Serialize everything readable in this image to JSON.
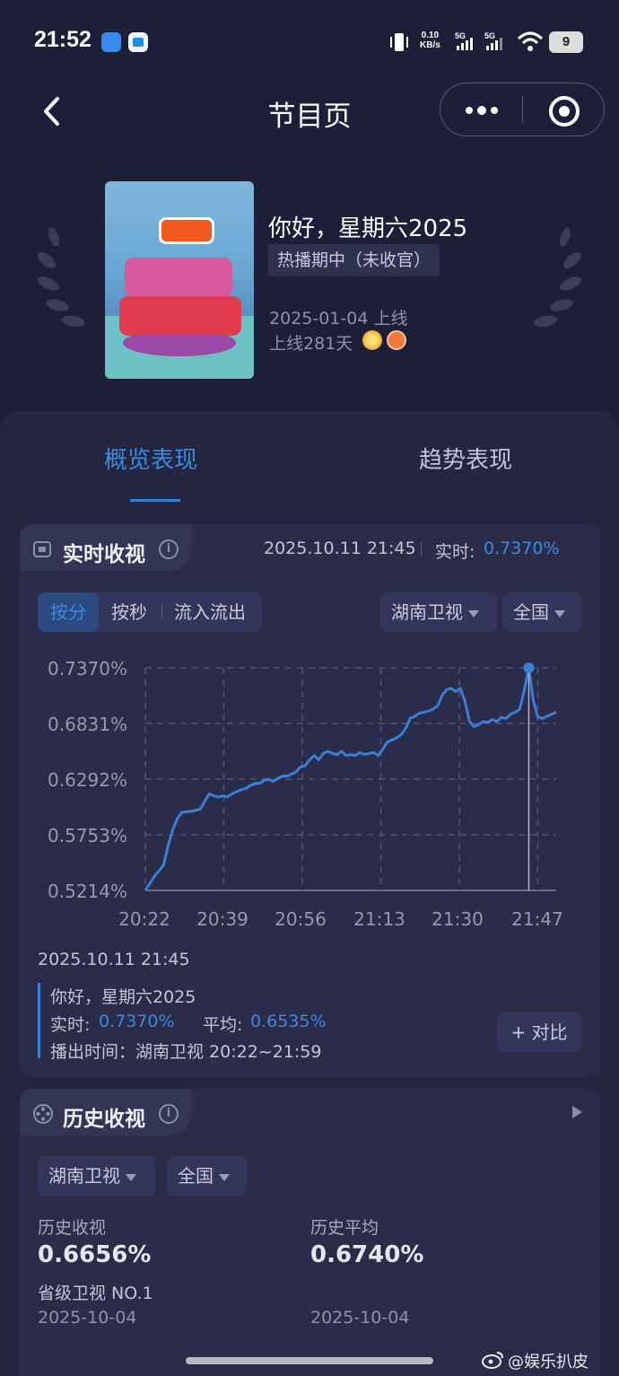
{
  "status_bar": {
    "time": "21:52",
    "net_speed_value": "0.10",
    "net_speed_unit": "KB/s",
    "sig1": "5G",
    "sig2": "5G",
    "battery": "9"
  },
  "nav": {
    "title": "节目页"
  },
  "show": {
    "title": "你好，星期六2025",
    "status": "热播期中（未收官）",
    "launch_date": "2025-01-04 上线",
    "launch_days": "上线281天"
  },
  "tabs": [
    "概览表现",
    "趋势表现"
  ],
  "realtime": {
    "title": "实时收视",
    "timestamp": "2025.10.11 21:45",
    "realtime_label": "实时:",
    "realtime_value": "0.7370%",
    "segments": [
      "按分",
      "按秒",
      "流入流出"
    ],
    "channel": "湖南卫视",
    "region": "全国",
    "detail_time": "2025.10.11 21:45",
    "detail_show": "你好，星期六2025",
    "detail_rt_label": "实时:",
    "detail_rt_value": "0.7370%",
    "detail_avg_label": "平均:",
    "detail_avg_value": "0.6535%",
    "air_time": "播出时间：湖南卫视 20:22~21:59",
    "compare_button": "+ 对比"
  },
  "chart_data": {
    "type": "line",
    "yticks": [
      "0.7370%",
      "0.6831%",
      "0.6292%",
      "0.5753%",
      "0.5214%"
    ],
    "xticks": [
      "20:22",
      "20:39",
      "20:56",
      "21:13",
      "21:30",
      "21:47"
    ],
    "ylim": [
      0.5214,
      0.737
    ],
    "xlim": [
      0,
      90
    ],
    "grid": true,
    "marker_x": 84,
    "series": [
      {
        "x": [
          0,
          2,
          4,
          5,
          6,
          7,
          8,
          10,
          12,
          14,
          15,
          16,
          17,
          18,
          19,
          20,
          21,
          22,
          23,
          24,
          25,
          26,
          27,
          28,
          29,
          30,
          31,
          32,
          33,
          34,
          35,
          36,
          37,
          38,
          39,
          40,
          41,
          42,
          43,
          44,
          45,
          46,
          47,
          48,
          49,
          50,
          51,
          52,
          53,
          54,
          55,
          56,
          57,
          58,
          59,
          60,
          61,
          62,
          63,
          64,
          65,
          66,
          67,
          68,
          69,
          70,
          71,
          72,
          73,
          74,
          75,
          76,
          77,
          78,
          79,
          80,
          81,
          82,
          83,
          84,
          85,
          86,
          87,
          88,
          89,
          90
        ],
        "y": [
          0.5214,
          0.535,
          0.546,
          0.565,
          0.58,
          0.591,
          0.597,
          0.598,
          0.6,
          0.615,
          0.613,
          0.612,
          0.613,
          0.612,
          0.615,
          0.617,
          0.619,
          0.62,
          0.623,
          0.625,
          0.625,
          0.628,
          0.629,
          0.627,
          0.63,
          0.632,
          0.632,
          0.634,
          0.636,
          0.641,
          0.642,
          0.648,
          0.652,
          0.648,
          0.654,
          0.656,
          0.654,
          0.653,
          0.656,
          0.652,
          0.653,
          0.652,
          0.655,
          0.653,
          0.654,
          0.655,
          0.652,
          0.658,
          0.665,
          0.667,
          0.669,
          0.672,
          0.678,
          0.688,
          0.69,
          0.693,
          0.694,
          0.695,
          0.697,
          0.7,
          0.71,
          0.716,
          0.717,
          0.714,
          0.717,
          0.705,
          0.685,
          0.68,
          0.682,
          0.685,
          0.684,
          0.687,
          0.685,
          0.689,
          0.688,
          0.692,
          0.694,
          0.697,
          0.715,
          0.737,
          0.705,
          0.689,
          0.688,
          0.69,
          0.692,
          0.694
        ]
      }
    ]
  },
  "history": {
    "title": "历史收视",
    "channel": "湖南卫视",
    "region": "全国",
    "hist_label": "历史收视",
    "hist_value": "0.6656%",
    "rank": "省级卫视 NO.1",
    "hist_date": "2025-10-04",
    "avg_label": "历史平均",
    "avg_value": "0.6740%",
    "avg_date": "2025-10-04"
  },
  "watermark": "@娱乐扒皮",
  "colors": {
    "background": "#1d1f38",
    "card": "#232541",
    "accent": "#3a8bdc",
    "line": "#3a7fd6"
  }
}
